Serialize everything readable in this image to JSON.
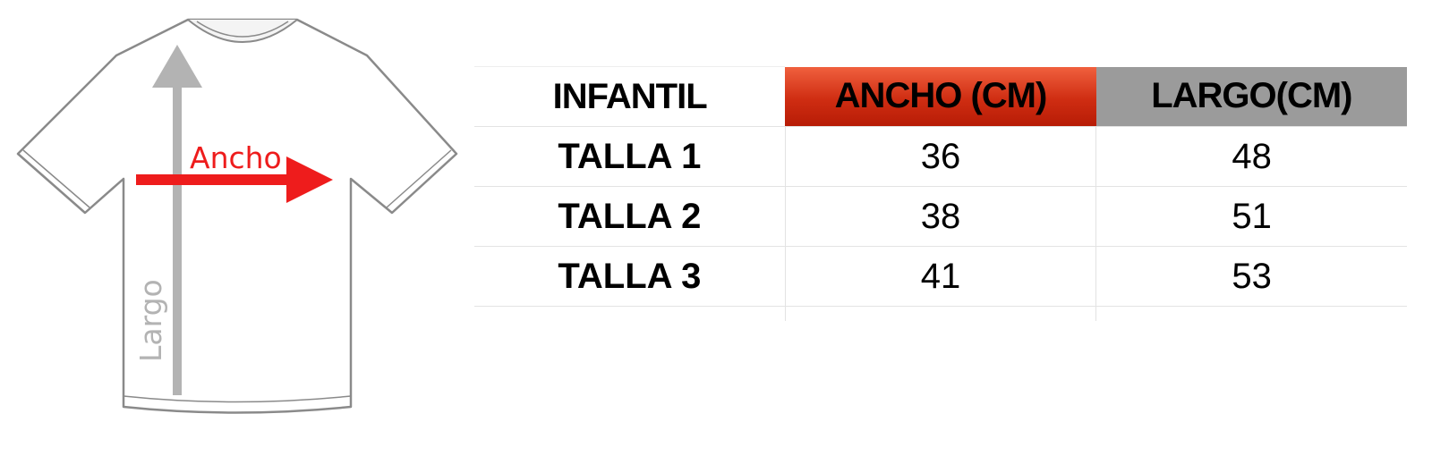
{
  "diagram": {
    "width_label": "Ancho",
    "length_label": "Largo",
    "colors": {
      "width_arrow": "#ee1c1c",
      "length_arrow": "#b3b3b3",
      "shirt_outline": "#8a8a8a"
    }
  },
  "table": {
    "headers": [
      "INFANTIL",
      "ANCHO (CM)",
      "LARGO(CM)"
    ],
    "header_colors": {
      "ancho": "#d9361a",
      "largo": "#9b9b9b"
    },
    "rows": [
      {
        "size": "TALLA 1",
        "ancho": "36",
        "largo": "48"
      },
      {
        "size": "TALLA 2",
        "ancho": "38",
        "largo": "51"
      },
      {
        "size": "TALLA 3",
        "ancho": "41",
        "largo": "53"
      }
    ]
  }
}
